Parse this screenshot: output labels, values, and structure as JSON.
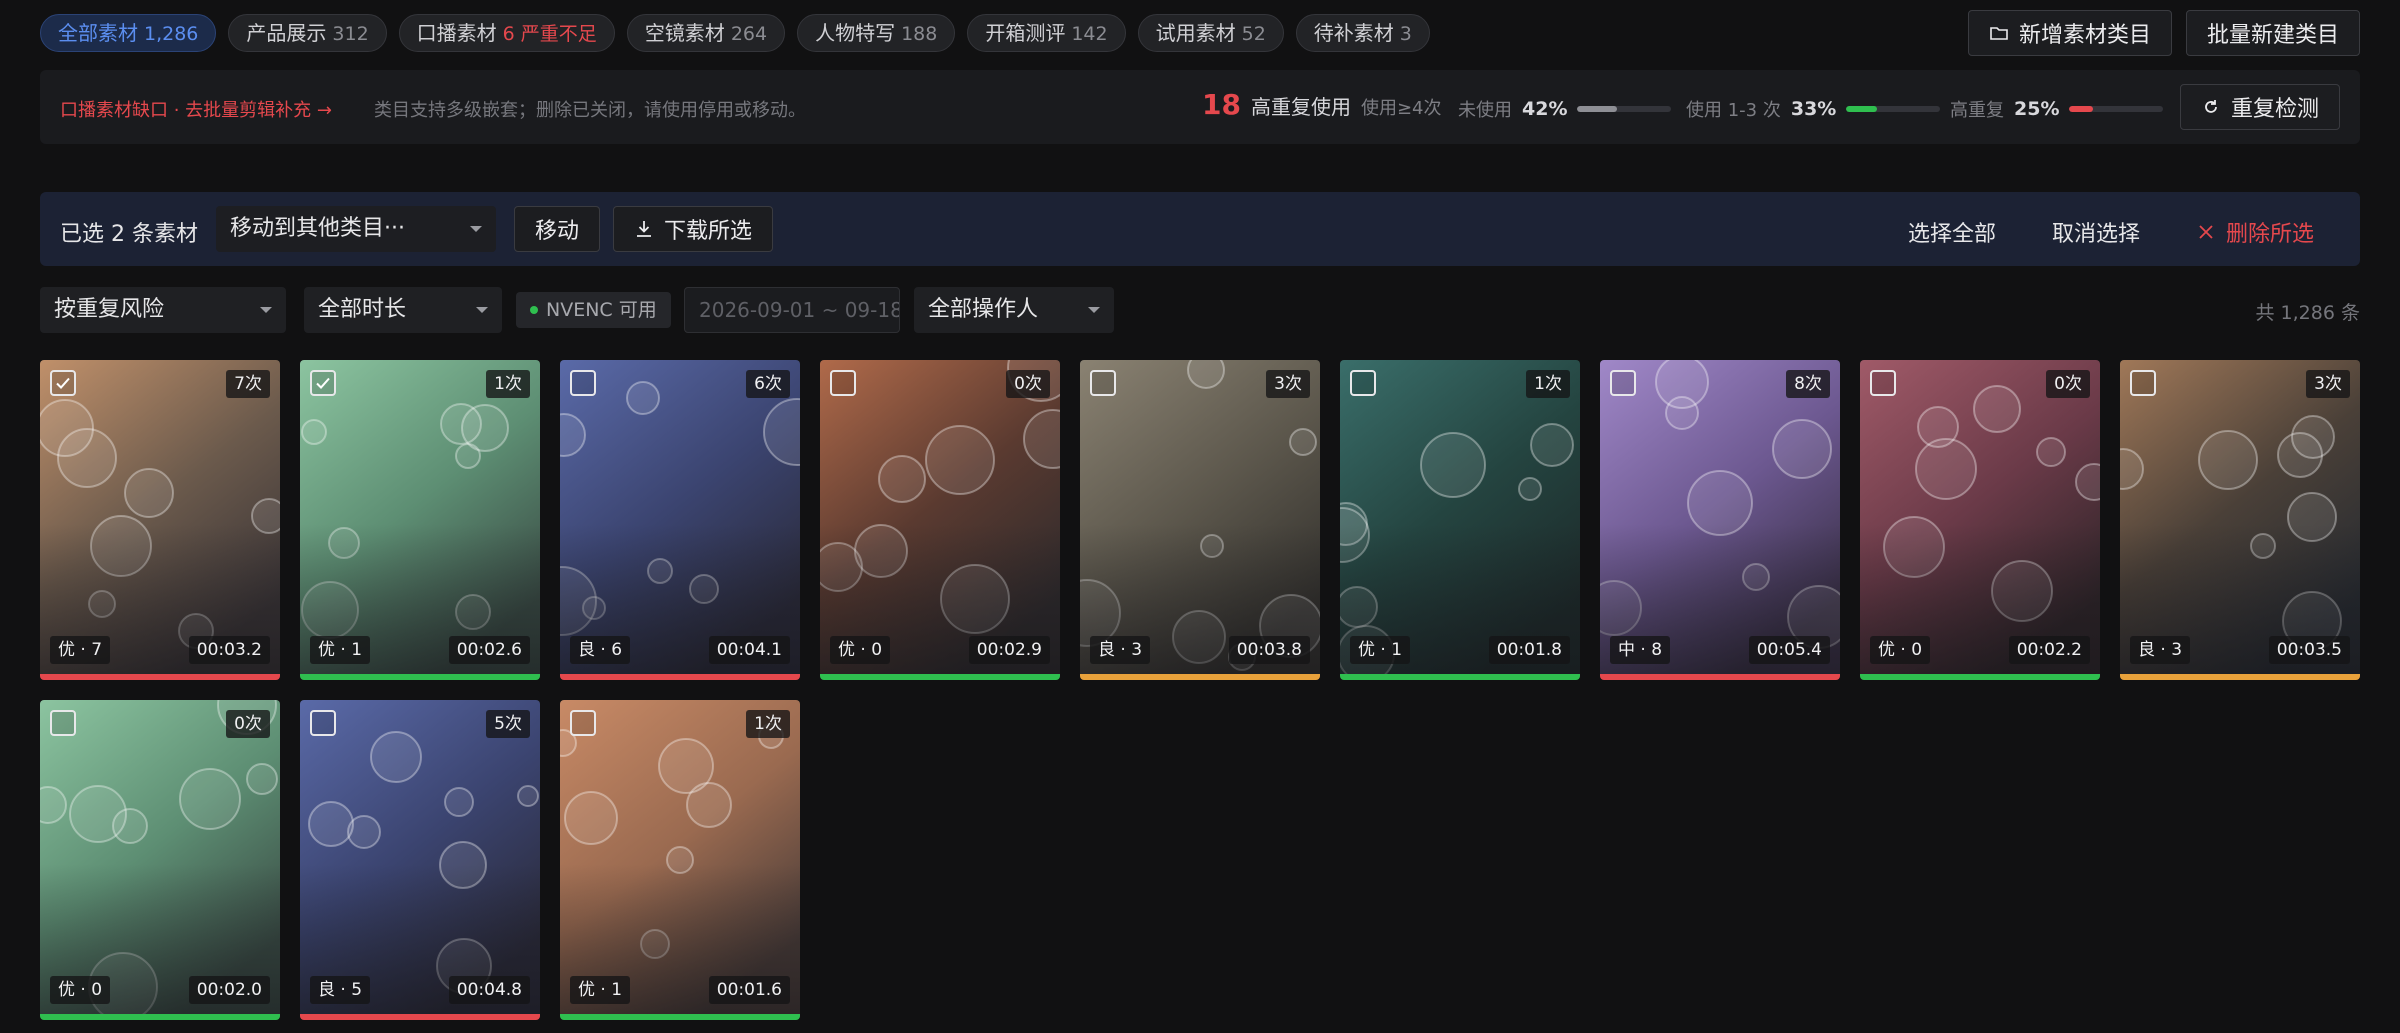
{
  "categories": [
    {
      "name": "全部素材",
      "count": "1,286",
      "active": true
    },
    {
      "name": "产品展示",
      "count": "312"
    },
    {
      "name": "口播素材",
      "warn": "6 严重不足"
    },
    {
      "name": "空镜素材",
      "count": "264"
    },
    {
      "name": "人物特写",
      "count": "188"
    },
    {
      "name": "开箱测评",
      "count": "142"
    },
    {
      "name": "试用素材",
      "count": "52"
    },
    {
      "name": "待补素材",
      "count": "3"
    }
  ],
  "top_actions": {
    "add_category": "新增素材类目",
    "batch_create": "批量新建类目"
  },
  "info": {
    "warning": "口播素材缺口 · 去批量剪辑补充 →",
    "hint": "类目支持多级嵌套；删除已关闭，请使用停用或移动。",
    "high_repeat_num": "18",
    "high_repeat_label": "高重复使用",
    "high_repeat_sub": "使用≥4次",
    "meters": [
      {
        "label": "未使用",
        "pct": "42%",
        "value": 0.42,
        "color": "#8e8f95"
      },
      {
        "label": "使用 1-3 次",
        "pct": "33%",
        "value": 0.33,
        "color": "#2fbf4f"
      },
      {
        "label": "高重复",
        "pct": "25%",
        "value": 0.25,
        "color": "#e5484d"
      }
    ],
    "recheck": "重复检测"
  },
  "selection": {
    "count_text": "已选 2 条素材",
    "move_target": "移动到其他类目···",
    "move": "移动",
    "download": "下载所选",
    "select_all": "选择全部",
    "cancel": "取消选择",
    "delete": "删除所选"
  },
  "filters": {
    "sort": "按重复风险",
    "duration": "全部时长",
    "nvenc": "NVENC 可用",
    "date_range": "2026-09-01 ~ 09-18",
    "operator": "全部操作人",
    "total": "共 1,286 条"
  },
  "colors": {
    "good": "#2fbf4f",
    "mid": "#e9a23b",
    "bad": "#e5484d",
    "accent": "#5b8ef0"
  },
  "cards": [
    {
      "uses": "7次",
      "grade": "优 · 7",
      "duration": "00:03.2",
      "checked": true,
      "tone": "warm",
      "status": "bad"
    },
    {
      "uses": "1次",
      "grade": "优 · 1",
      "duration": "00:02.6",
      "checked": true,
      "tone": "green",
      "status": "good"
    },
    {
      "uses": "6次",
      "grade": "良 · 6",
      "duration": "00:04.1",
      "checked": false,
      "tone": "blue",
      "status": "bad"
    },
    {
      "uses": "0次",
      "grade": "优 · 0",
      "duration": "00:02.9",
      "checked": false,
      "tone": "amber",
      "status": "good"
    },
    {
      "uses": "3次",
      "grade": "良 · 3",
      "duration": "00:03.8",
      "checked": false,
      "tone": "sand",
      "status": "mid"
    },
    {
      "uses": "1次",
      "grade": "优 · 1",
      "duration": "00:01.8",
      "checked": false,
      "tone": "teal",
      "status": "good"
    },
    {
      "uses": "8次",
      "grade": "中 · 8",
      "duration": "00:05.4",
      "checked": false,
      "tone": "purple",
      "status": "bad"
    },
    {
      "uses": "0次",
      "grade": "优 · 0",
      "duration": "00:02.2",
      "checked": false,
      "tone": "rose",
      "status": "good"
    },
    {
      "uses": "3次",
      "grade": "良 · 3",
      "duration": "00:03.5",
      "checked": false,
      "tone": "bronze",
      "status": "mid"
    },
    {
      "uses": "0次",
      "grade": "优 · 0",
      "duration": "00:02.0",
      "checked": false,
      "tone": "green",
      "status": "good"
    },
    {
      "uses": "5次",
      "grade": "良 · 5",
      "duration": "00:04.8",
      "checked": false,
      "tone": "blue",
      "status": "bad"
    },
    {
      "uses": "1次",
      "grade": "优 · 1",
      "duration": "00:01.6",
      "checked": false,
      "tone": "peach",
      "status": "good"
    }
  ]
}
